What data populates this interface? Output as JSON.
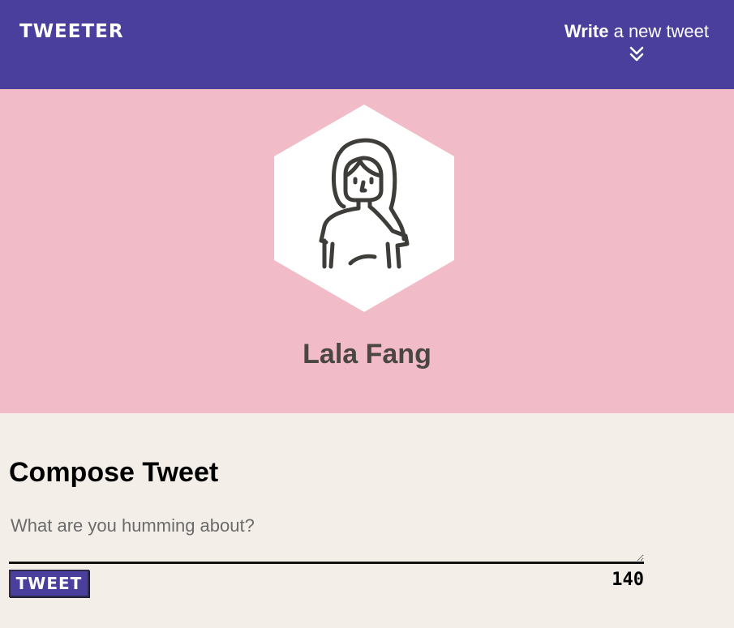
{
  "nav": {
    "brand": "TWEETER",
    "write_bold": "Write",
    "write_rest": " a new tweet",
    "toggle_icon": "double-chevron-down-icon"
  },
  "profile": {
    "name": "Lala Fang",
    "avatar_icon": "female-user-avatar-icon"
  },
  "compose": {
    "title": "Compose Tweet",
    "placeholder": "What are you humming about?",
    "value": "",
    "button_label": "TWEET",
    "char_count": "140"
  },
  "colors": {
    "nav_bg": "#4a3f9c",
    "banner_bg": "#f1bcc8",
    "page_bg": "#f3efe8",
    "button_bg": "#4a3f9c",
    "name_text": "#4a4642"
  }
}
